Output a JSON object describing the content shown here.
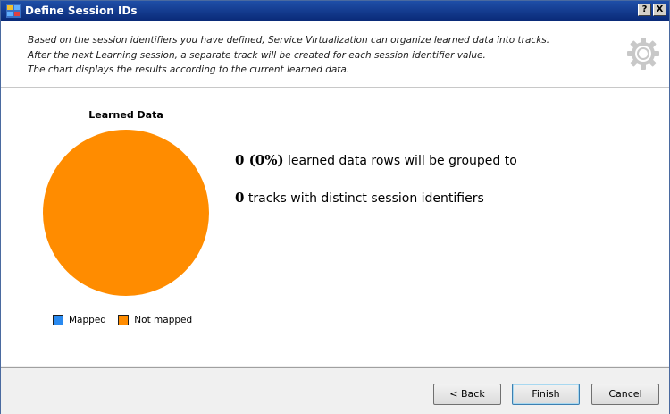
{
  "window": {
    "title": "Define Session IDs",
    "help_button": "?",
    "close_button": "X"
  },
  "header": {
    "lines": [
      "Based on the session identifiers you have defined, Service Virtualization can organize learned data into tracks.",
      "After the next Learning session, a separate track will be created for each session identifier value.",
      "The chart displays the results according to the current learned data."
    ],
    "icon": "gear-icon"
  },
  "chart_data": {
    "type": "pie",
    "title": "Learned Data",
    "categories": [
      "Mapped",
      "Not mapped"
    ],
    "values": [
      0,
      100
    ],
    "colors": [
      "#2a8af0",
      "#ff8c00"
    ],
    "legend_position": "bottom"
  },
  "summary": {
    "rows_value": "0 (0%)",
    "rows_text": " learned data rows will be grouped to",
    "tracks_value": "0",
    "tracks_text": " tracks with distinct session identifiers"
  },
  "buttons": {
    "back": "< Back",
    "finish": "Finish",
    "cancel": "Cancel"
  }
}
